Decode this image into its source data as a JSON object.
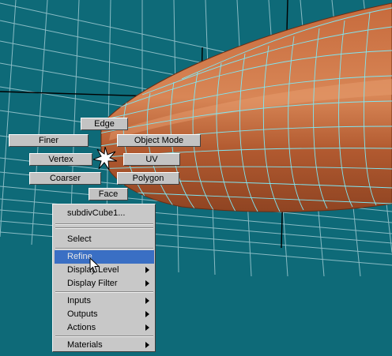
{
  "viewport": {
    "background": "#0e6a78",
    "grid_color": "#9fcad2",
    "surface_color": "#c66a3c",
    "wire_color": "#7fe6f2"
  },
  "marking_menu": {
    "edge": "Edge",
    "finer": "Finer",
    "object_mode": "Object Mode",
    "vertex": "Vertex",
    "uv": "UV",
    "coarser": "Coarser",
    "polygon": "Polygon",
    "face": "Face"
  },
  "popup_menu": {
    "header": "subdivCube1...",
    "items": [
      {
        "label": "Select",
        "submenu": false
      },
      {
        "label": "Refine",
        "submenu": false,
        "highlighted": true
      },
      {
        "label": "Display Level",
        "submenu": true
      },
      {
        "label": "Display Filter",
        "submenu": true
      },
      {
        "label": "Inputs",
        "submenu": true
      },
      {
        "label": "Outputs",
        "submenu": true
      },
      {
        "label": "Actions",
        "submenu": true
      },
      {
        "label": "Materials",
        "submenu": true
      }
    ],
    "highlight_color": "#3a6fc4"
  }
}
